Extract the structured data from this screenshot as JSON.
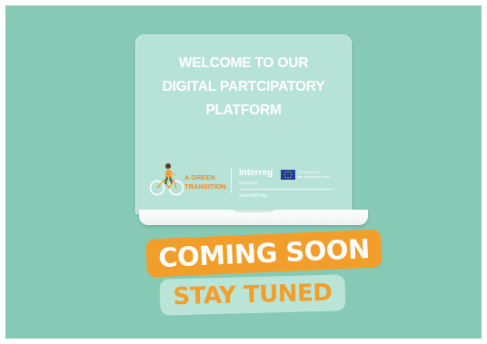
{
  "colors": {
    "background": "#86cab6",
    "screen": "#b7e2d7",
    "accent_orange": "#f29e2b",
    "mint_banner": "#b9e4d6"
  },
  "screen": {
    "headline_line1": "WELCOME TO OUR",
    "headline_line2": "DIGITAL PARTCIPATORY",
    "headline_line3": "PLATFORM"
  },
  "logos": {
    "green_transition_line1": "A GREEN",
    "green_transition_line2": "TRANSITION",
    "cyclist_icon": "cyclist-icon",
    "interreg": "Interreg",
    "interreg_sub": "North Sea",
    "eu_flag_icon": "eu-flag-icon",
    "cofunded_line1": "Co-funded by",
    "cofunded_line2": "the European Union",
    "project_name": "ShareDiff Hub"
  },
  "banners": {
    "coming_soon": "COMING SOON",
    "stay_tuned": "STAY TUNED"
  }
}
